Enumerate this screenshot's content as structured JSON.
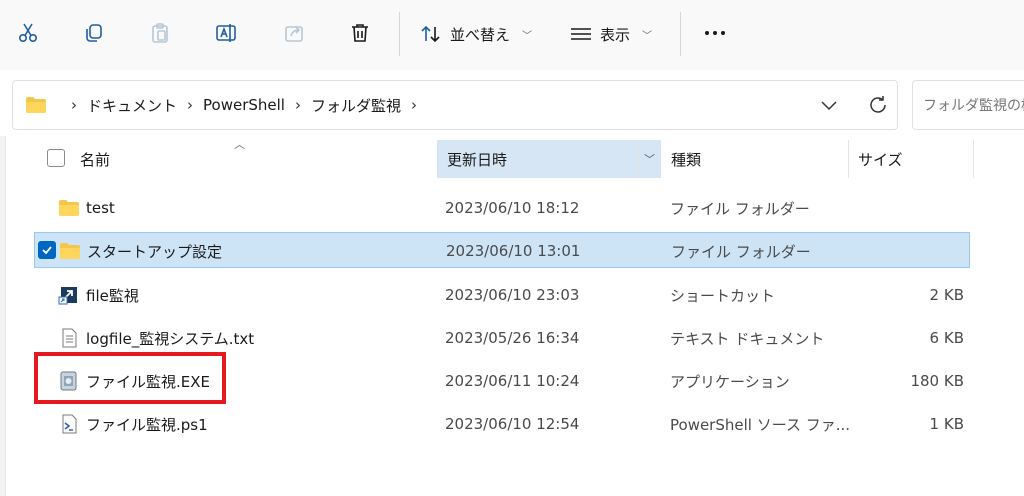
{
  "toolbar": {
    "sort_label": "並べ替え",
    "view_label": "表示"
  },
  "address": {
    "crumbs": [
      "ドキュメント",
      "PowerShell",
      "フォルダ監視"
    ],
    "search_placeholder": "フォルダ監視の検"
  },
  "columns": {
    "name": "名前",
    "date": "更新日時",
    "type": "種類",
    "size": "サイズ"
  },
  "files": [
    {
      "name": "test",
      "date": "2023/06/10 18:12",
      "type": "ファイル フォルダー",
      "size": "",
      "icon": "folder-icon"
    },
    {
      "name": "スタートアップ設定",
      "date": "2023/06/10 13:01",
      "type": "ファイル フォルダー",
      "size": "",
      "icon": "folder-icon",
      "selected": true
    },
    {
      "name": "file監視",
      "date": "2023/06/10 23:03",
      "type": "ショートカット",
      "size": "2 KB",
      "icon": "shortcut-icon"
    },
    {
      "name": "logfile_監視システム.txt",
      "date": "2023/05/26 16:34",
      "type": "テキスト ドキュメント",
      "size": "6 KB",
      "icon": "text-file-icon"
    },
    {
      "name": "ファイル監視.EXE",
      "date": "2023/06/11 10:24",
      "type": "アプリケーション",
      "size": "180 KB",
      "icon": "application-icon"
    },
    {
      "name": "ファイル監視.ps1",
      "date": "2023/06/10 12:54",
      "type": "PowerShell ソース ファ...",
      "size": "1 KB",
      "icon": "powershell-script-icon"
    }
  ],
  "colors": {
    "accent": "#0067c0",
    "selection": "#cde4f7",
    "highlight_box": "#e5191f"
  }
}
